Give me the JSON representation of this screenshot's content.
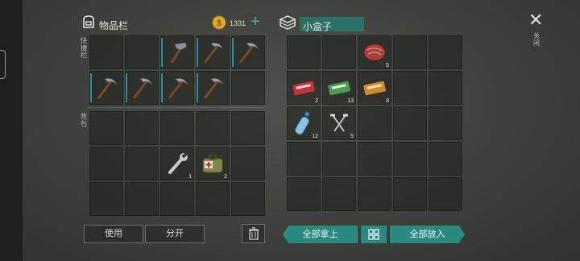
{
  "inventory": {
    "title": "物品栏",
    "coin_count": "1331",
    "plus_label": "+",
    "hotbar_label": "快捷栏",
    "backpack_label": "背包",
    "slots": [
      {
        "item": "",
        "qty": "",
        "durability": 0
      },
      {
        "item": "",
        "qty": "",
        "durability": 0
      },
      {
        "item": "hammer",
        "qty": "",
        "durability": 1
      },
      {
        "item": "pickaxe",
        "qty": "",
        "durability": 1
      },
      {
        "item": "pickaxe",
        "qty": "",
        "durability": 1
      },
      {
        "item": "pickaxe",
        "qty": "",
        "durability": 1
      },
      {
        "item": "pickaxe",
        "qty": "",
        "durability": 1
      },
      {
        "item": "pickaxe",
        "qty": "",
        "durability": 1
      },
      {
        "item": "pickaxe",
        "qty": "",
        "durability": 1
      },
      {
        "item": "",
        "qty": "",
        "durability": 0
      },
      {
        "item": "",
        "qty": ""
      },
      {
        "item": "",
        "qty": ""
      },
      {
        "item": "",
        "qty": ""
      },
      {
        "item": "",
        "qty": ""
      },
      {
        "item": "",
        "qty": ""
      },
      {
        "item": "",
        "qty": ""
      },
      {
        "item": "",
        "qty": ""
      },
      {
        "item": "wrench",
        "qty": "1"
      },
      {
        "item": "medkit",
        "qty": "2"
      },
      {
        "item": "",
        "qty": ""
      },
      {
        "item": "",
        "qty": ""
      },
      {
        "item": "",
        "qty": ""
      },
      {
        "item": "",
        "qty": ""
      },
      {
        "item": "",
        "qty": ""
      },
      {
        "item": "",
        "qty": ""
      }
    ],
    "use_button": "使用",
    "split_button": "分开"
  },
  "box": {
    "title": "小盒子",
    "slots": [
      {
        "item": "",
        "qty": ""
      },
      {
        "item": "",
        "qty": ""
      },
      {
        "item": "meat",
        "qty": "5"
      },
      {
        "item": "",
        "qty": ""
      },
      {
        "item": "",
        "qty": ""
      },
      {
        "item": "red-ticket",
        "qty": "2"
      },
      {
        "item": "green-ticket",
        "qty": "13"
      },
      {
        "item": "orange-ticket",
        "qty": "8"
      },
      {
        "item": "",
        "qty": ""
      },
      {
        "item": "",
        "qty": ""
      },
      {
        "item": "water-bottle",
        "qty": "12"
      },
      {
        "item": "nails",
        "qty": "5"
      },
      {
        "item": "",
        "qty": ""
      },
      {
        "item": "",
        "qty": ""
      },
      {
        "item": "",
        "qty": ""
      },
      {
        "item": "",
        "qty": ""
      },
      {
        "item": "",
        "qty": ""
      },
      {
        "item": "",
        "qty": ""
      },
      {
        "item": "",
        "qty": ""
      },
      {
        "item": "",
        "qty": ""
      },
      {
        "item": "",
        "qty": ""
      },
      {
        "item": "",
        "qty": ""
      },
      {
        "item": "",
        "qty": ""
      },
      {
        "item": "",
        "qty": ""
      },
      {
        "item": "",
        "qty": ""
      }
    ],
    "take_all_button": "全部拿上",
    "put_all_button": "全部放入"
  },
  "close_label": "关闭",
  "colors": {
    "teal": "#2b8a80",
    "durability": "#2a8fa0",
    "coin": "#e3a825"
  }
}
